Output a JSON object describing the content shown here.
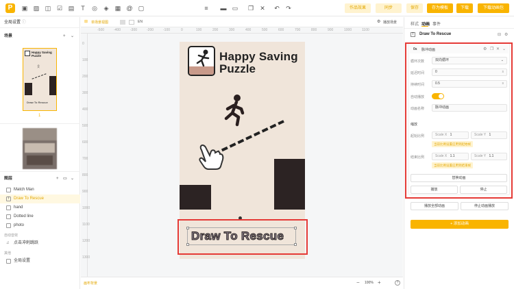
{
  "topbar": {
    "logo": "P",
    "tool_icons": [
      "image-icon",
      "photo-icon",
      "box-icon",
      "checkbox-icon",
      "note-icon",
      "text-icon",
      "target-icon",
      "layers-icon",
      "grid-icon",
      "at-icon",
      "frame-icon"
    ],
    "btn_preview": "作品效果",
    "btn_sync": "同步",
    "btn_save": "保存",
    "btn_save_template": "存为模板",
    "btn_download": "下载",
    "btn_download_anim": "下载动画包"
  },
  "left": {
    "global_settings": "全局设置",
    "scenes_label": "场景",
    "scene1_num": "1",
    "thumb_title_1": "Happy Saving",
    "thumb_title_2": "Puzzle",
    "thumb_caption": "Draw To Rescue",
    "layers_label": "图层",
    "layers": [
      {
        "icon": "image-icon",
        "label": "Match Man"
      },
      {
        "icon": "text-icon",
        "label": "Draw To Rescue"
      },
      {
        "icon": "image-icon",
        "label": "hand"
      },
      {
        "icon": "image-icon",
        "label": "Dotted line"
      },
      {
        "icon": "image-icon",
        "label": "photo"
      }
    ],
    "audio_section": "自动音效",
    "audio_item": "点击冲刺跳跃",
    "other_section": "其他",
    "global_item": "全局设置"
  },
  "canvas": {
    "toolbar_item": "单场景视图",
    "lang": "EN",
    "play_scene": "播放场景",
    "ruler_top": [
      "-500",
      "-400",
      "-300",
      "-200",
      "-100",
      "0",
      "100",
      "200",
      "300",
      "400",
      "500",
      "600",
      "700",
      "800",
      "900",
      "1000",
      "1100"
    ],
    "ruler_left": [
      "0",
      "100",
      "200",
      "300",
      "400",
      "500",
      "600",
      "700",
      "800",
      "900",
      "1000",
      "1100",
      "1200",
      "1300"
    ],
    "art_title_1": "Happy Saving",
    "art_title_2": "Puzzle",
    "art_caption": "Draw To Rescue",
    "bottom_left": "画布背景",
    "zoom": "100%",
    "zoom_minus": "−",
    "zoom_plus": "+",
    "help": "?"
  },
  "right": {
    "tabs": [
      "样式",
      "动画",
      "事件"
    ],
    "element_name": "Draw To Rescue",
    "anim_time": "0s",
    "anim_name": "脉冲动画",
    "fields": [
      {
        "label": "循环次数",
        "value": "双向循环"
      },
      {
        "label": "延迟时间",
        "value": "0",
        "unit": "s"
      },
      {
        "label": "持续时间",
        "value": "0.5",
        "unit": "s"
      }
    ],
    "autoplay_label": "自动播放",
    "anim_name_label": "动画名称",
    "anim_name_value": "脉冲动画",
    "scale_section": "缩放",
    "start_scale_label": "起始比例",
    "start_scale_x_label": "Scale X",
    "start_scale_x": "1",
    "start_scale_y_label": "Scale Y",
    "start_scale_y": "1",
    "start_hint": "当前比例设置应用到起始帧",
    "end_scale_label": "结束比例",
    "end_scale_x_label": "Scale X",
    "end_scale_x": "1.1",
    "end_scale_y_label": "Scale Y",
    "end_scale_y": "1.1",
    "end_hint": "当前比例设置应用到结束帧",
    "replace_anim": "替换动画",
    "play": "播放",
    "stop": "停止",
    "play_all": "播放全部动画",
    "stop_all": "停止动画播放",
    "add_anim": "+ 添加动画"
  },
  "colors": {
    "accent": "#f9b400",
    "highlight": "#e53935"
  }
}
